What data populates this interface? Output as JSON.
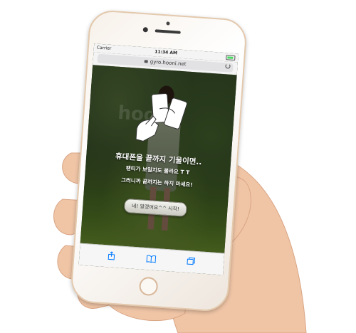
{
  "status_bar": {
    "carrier": "Carrier",
    "time": "11:34 AM"
  },
  "browser": {
    "url": "gyro.hooni.net"
  },
  "watermark": "hooni",
  "page": {
    "title": "휴대폰을 끝까지 기울이면..",
    "line1": "팬티가 보일지도 몰라요 T  T",
    "line2": "그러니까 끝까지는 하지 마세요!",
    "start_button": "네! 알겠어요^^ 시작!"
  },
  "toolbar": {
    "icons": [
      "share-icon",
      "bookmarks-icon",
      "tabs-icon"
    ]
  },
  "colors": {
    "accent": "#007aff",
    "phone_gold": "#e3c9ad"
  }
}
